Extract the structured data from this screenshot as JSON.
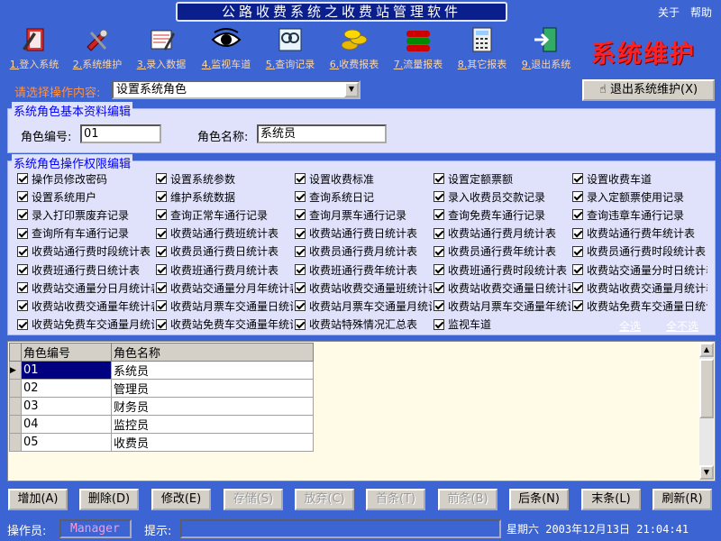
{
  "window": {
    "title": "公路收费系统之收费站管理软件",
    "about": "关于",
    "help": "帮助"
  },
  "toolbar": {
    "items": [
      {
        "num": "1.",
        "label": "登入系统",
        "icon": "login-icon"
      },
      {
        "num": "2.",
        "label": "系统维护",
        "icon": "maintenance-icon"
      },
      {
        "num": "3.",
        "label": "录入数据",
        "icon": "data-entry-icon"
      },
      {
        "num": "4.",
        "label": "监视车道",
        "icon": "eye-icon"
      },
      {
        "num": "5.",
        "label": "查询记录",
        "icon": "query-icon"
      },
      {
        "num": "6.",
        "label": "收费报表",
        "icon": "coins-icon"
      },
      {
        "num": "7.",
        "label": "流量报表",
        "icon": "traffic-icon"
      },
      {
        "num": "8.",
        "label": "其它报表",
        "icon": "calculator-icon"
      },
      {
        "num": "9.",
        "label": "退出系统",
        "icon": "exit-icon"
      }
    ]
  },
  "section_title": "系统维护",
  "op": {
    "label": "请选择操作内容:",
    "selected": "设置系统角色",
    "exit_button": "退出系统维护(X)"
  },
  "basic": {
    "legend": "系统角色基本资料编辑",
    "id_label": "角色编号:",
    "id_value": "01",
    "name_label": "角色名称:",
    "name_value": "系统员"
  },
  "perm": {
    "legend": "系统角色操作权限编辑",
    "select_all": "全选",
    "select_none": "全不选",
    "items": [
      "操作员修改密码",
      "设置系统参数",
      "设置收费标准",
      "设置定额票额",
      "设置收费车道",
      "设置系统用户",
      "维护系统数据",
      "查询系统日记",
      "录入收费员交款记录",
      "录入定额票使用记录",
      "录入打印票废弃记录",
      "查询正常车通行记录",
      "查询月票车通行记录",
      "查询免费车通行记录",
      "查询违章车通行记录",
      "查询所有车通行记录",
      "收费站通行费班统计表",
      "收费站通行费日统计表",
      "收费站通行费月统计表",
      "收费站通行费年统计表",
      "收费站通行费时段统计表",
      "收费员通行费日统计表",
      "收费员通行费月统计表",
      "收费员通行费年统计表",
      "收费员通行费时段统计表",
      "收费班通行费日统计表",
      "收费班通行费月统计表",
      "收费班通行费年统计表",
      "收费班通行费时段统计表",
      "收费站交通量分时日统计表",
      "收费站交通量分日月统计表",
      "收费站交通量分月年统计表",
      "收费站收费交通量班统计表",
      "收费站收费交通量日统计表",
      "收费站收费交通量月统计表",
      "收费站收费交通量年统计表",
      "收费站月票车交通量日统计表",
      "收费站月票车交通量月统计表",
      "收费站月票车交通量年统计表",
      "收费站免费车交通量日统计表",
      "收费站免费车交通量月统计表",
      "收费站免费车交通量年统计表",
      "收费站特殊情况汇总表",
      "监视车道"
    ]
  },
  "grid": {
    "columns": [
      "角色编号",
      "角色名称"
    ],
    "rows": [
      [
        "01",
        "系统员"
      ],
      [
        "02",
        "管理员"
      ],
      [
        "03",
        "财务员"
      ],
      [
        "04",
        "监控员"
      ],
      [
        "05",
        "收费员"
      ]
    ]
  },
  "buttons": [
    {
      "label": "增加(A)",
      "enabled": true
    },
    {
      "label": "删除(D)",
      "enabled": true
    },
    {
      "label": "修改(E)",
      "enabled": true
    },
    {
      "label": "存储(S)",
      "enabled": false
    },
    {
      "label": "放弃(C)",
      "enabled": false
    },
    {
      "label": "首条(T)",
      "enabled": false
    },
    {
      "label": "前条(B)",
      "enabled": false
    },
    {
      "label": "后条(N)",
      "enabled": true
    },
    {
      "label": "末条(L)",
      "enabled": true
    },
    {
      "label": "刷新(R)",
      "enabled": true
    }
  ],
  "status": {
    "operator_label": "操作员:",
    "operator": "Manager",
    "hint_label": "提示:",
    "hint": "",
    "datetime": "星期六 2003年12月13日 21:04:41"
  }
}
